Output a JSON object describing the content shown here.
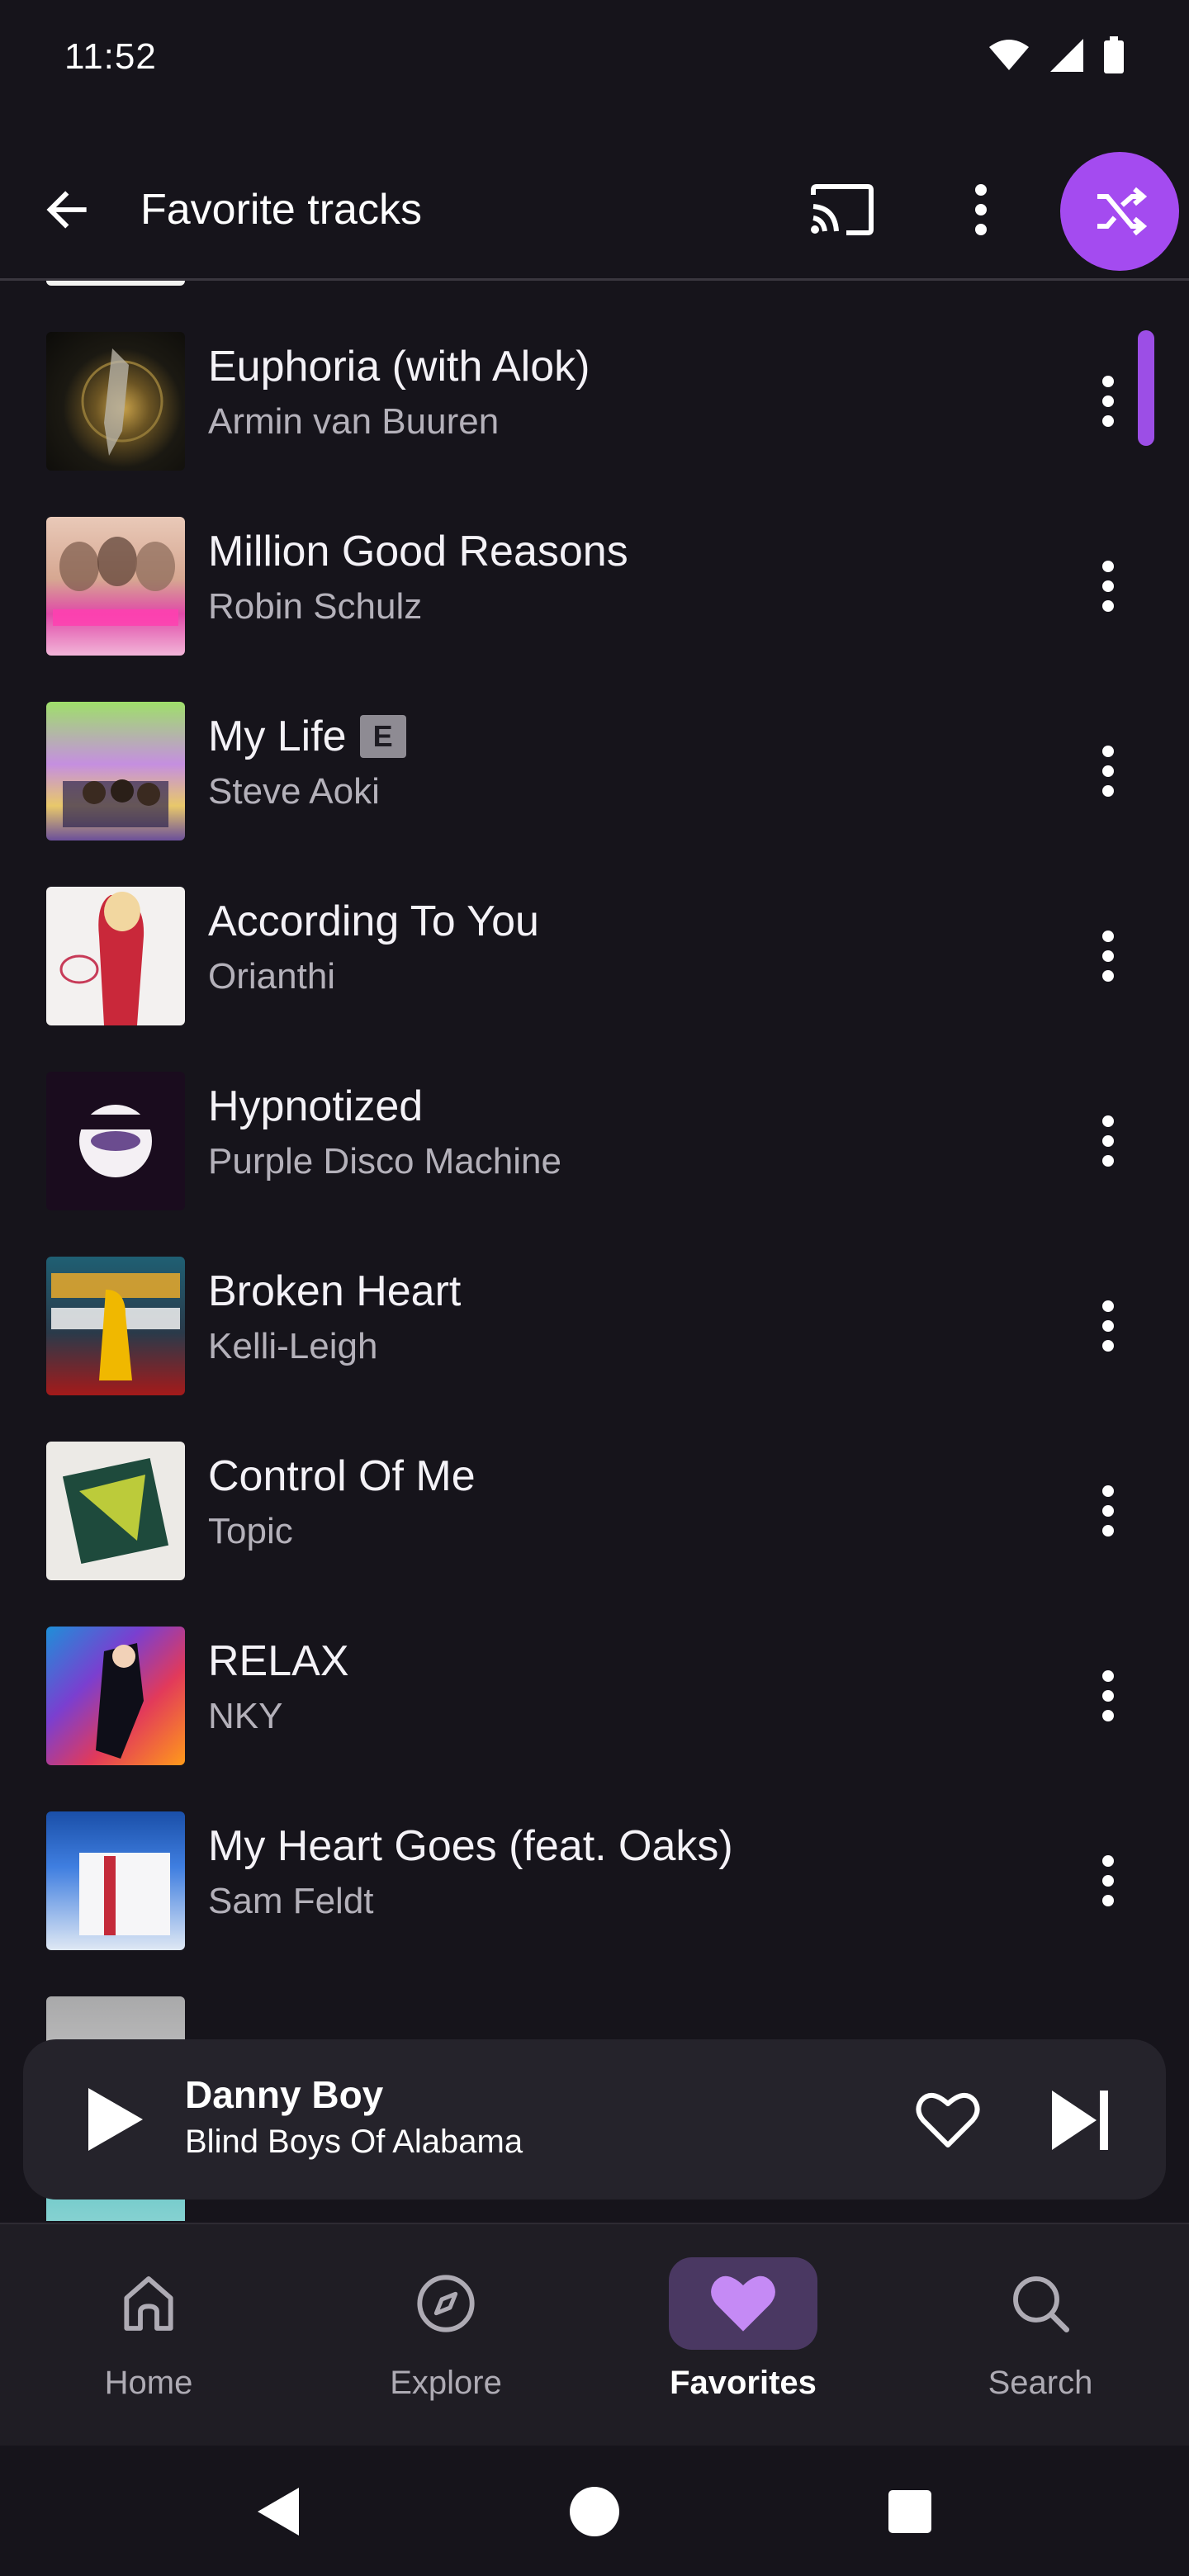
{
  "status_bar": {
    "time": "11:52"
  },
  "app_bar": {
    "title": "Favorite tracks"
  },
  "tracks": [
    {
      "title": "Euphoria (with Alok)",
      "artist": "Armin van Buuren",
      "explicit": false
    },
    {
      "title": "Million Good Reasons",
      "artist": "Robin Schulz",
      "explicit": false
    },
    {
      "title": "My Life",
      "artist": "Steve Aoki",
      "explicit": true,
      "explicit_label": "E"
    },
    {
      "title": "According To You",
      "artist": "Orianthi",
      "explicit": false
    },
    {
      "title": "Hypnotized",
      "artist": "Purple Disco Machine",
      "explicit": false
    },
    {
      "title": "Broken Heart",
      "artist": "Kelli-Leigh",
      "explicit": false
    },
    {
      "title": "Control Of Me",
      "artist": "Topic",
      "explicit": false
    },
    {
      "title": "RELAX",
      "artist": "NKY",
      "explicit": false
    },
    {
      "title": "My Heart Goes (feat. Oaks)",
      "artist": "Sam Feldt",
      "explicit": false
    }
  ],
  "mini_player": {
    "title": "Danny Boy",
    "artist": "Blind Boys Of Alabama"
  },
  "bottom_nav": {
    "items": [
      {
        "label": "Home",
        "icon": "home-icon",
        "active": false
      },
      {
        "label": "Explore",
        "icon": "compass-icon",
        "active": false
      },
      {
        "label": "Favorites",
        "icon": "heart-icon",
        "active": true
      },
      {
        "label": "Search",
        "icon": "search-icon",
        "active": false
      }
    ]
  },
  "colors": {
    "background": "#16141b",
    "accent": "#a44bf0",
    "active_nav_pill": "#4a3862",
    "mini_player_bg": "#25232b"
  }
}
